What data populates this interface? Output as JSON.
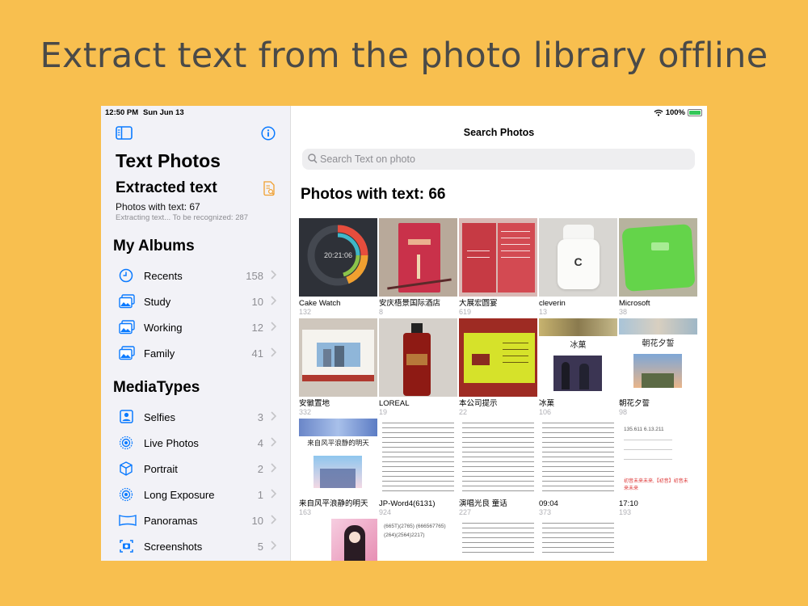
{
  "headline": "Extract text from the photo library offline",
  "status_bar": {
    "time": "12:50 PM",
    "date": "Sun Jun 13",
    "battery": "100%"
  },
  "sidebar": {
    "title": "Text Photos",
    "subtitle": "Extracted text",
    "photos_count": "Photos with text: 67",
    "extracting": "Extracting text... To be recognized: 287",
    "albums_header": "My Albums",
    "albums": [
      {
        "label": "Recents",
        "count": "158",
        "icon": "clock-icon"
      },
      {
        "label": "Study",
        "count": "10",
        "icon": "photo-stack-icon"
      },
      {
        "label": "Working",
        "count": "12",
        "icon": "photo-stack-icon"
      },
      {
        "label": "Family",
        "count": "41",
        "icon": "photo-stack-icon"
      }
    ],
    "mediatypes_header": "MediaTypes",
    "mediatypes": [
      {
        "label": "Selfies",
        "count": "3",
        "icon": "person-square-icon"
      },
      {
        "label": "Live Photos",
        "count": "4",
        "icon": "live-photo-icon"
      },
      {
        "label": "Portrait",
        "count": "2",
        "icon": "cube-icon"
      },
      {
        "label": "Long Exposure",
        "count": "1",
        "icon": "long-exposure-icon"
      },
      {
        "label": "Panoramas",
        "count": "10",
        "icon": "panorama-icon"
      },
      {
        "label": "Screenshots",
        "count": "5",
        "icon": "screenshot-icon"
      }
    ]
  },
  "main": {
    "title": "Search Photos",
    "search_placeholder": "Search Text on photo",
    "photos_header": "Photos with text: 66",
    "photos": [
      {
        "caption": "Cake Watch",
        "count": "132"
      },
      {
        "caption": "安庆梧景国际酒店",
        "count": "8"
      },
      {
        "caption": "大展宏圆宴",
        "count": "619"
      },
      {
        "caption": "cleverin",
        "count": "13"
      },
      {
        "caption": "Microsoft",
        "count": "38"
      },
      {
        "caption": "安徽置地",
        "count": "332"
      },
      {
        "caption": "LOREAL",
        "count": "19"
      },
      {
        "caption": "本公司提示",
        "count": "22"
      },
      {
        "caption": "冰菓",
        "count": "106"
      },
      {
        "caption": "朝花夕誓",
        "count": "98"
      },
      {
        "caption": "来自风平浪静的明天",
        "count": "163"
      },
      {
        "caption": "JP-Word4(6131)",
        "count": "924"
      },
      {
        "caption": "演唱光良 童话",
        "count": "227"
      },
      {
        "caption": "09:04",
        "count": "373"
      },
      {
        "caption": "17:10",
        "count": "193"
      }
    ],
    "thumb_text": {
      "watch_time": "20:21:06",
      "clever_logo": "C",
      "hyouka": "冰菓",
      "chouka": "朝花夕誓",
      "nagiasu": "来自风平浪静的明天",
      "notes": "135.611 6.13.211",
      "jp_lines": "(665T)(2765) (666567765) (264)(2564)2217)",
      "red_text": "初音未来未来,【初音】初音未来未来"
    }
  }
}
